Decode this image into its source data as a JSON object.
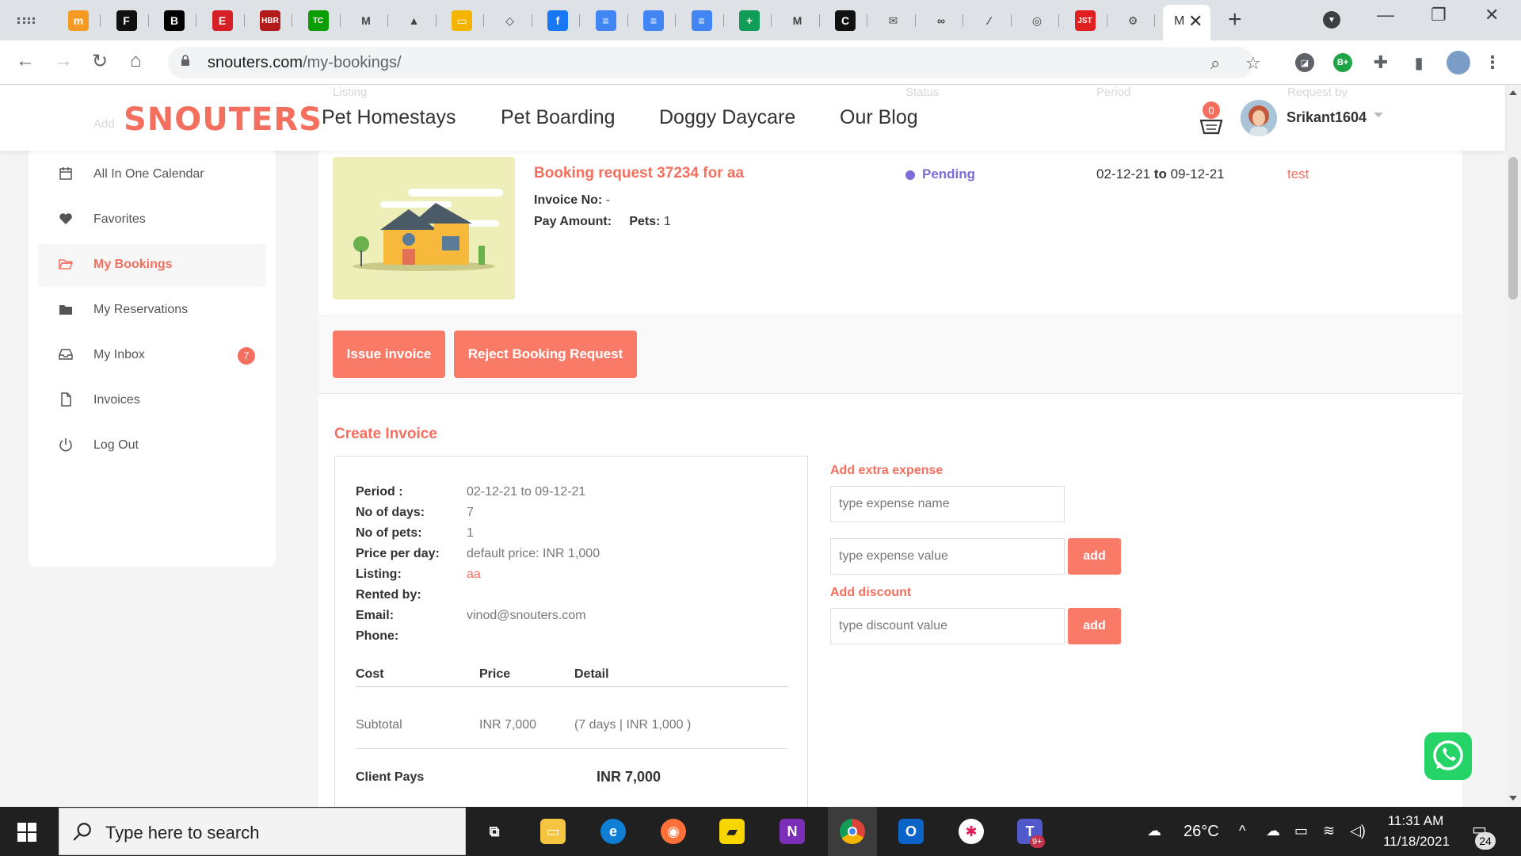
{
  "browser": {
    "active_tab_title": "M",
    "new_tab_glyph": "+",
    "url_host": "snouters.com",
    "url_path": "/my-bookings/",
    "tabs": [
      {
        "label": "m",
        "color": "#f59a23"
      },
      {
        "label": "F",
        "color": "#111111"
      },
      {
        "label": "B",
        "color": "#000000"
      },
      {
        "label": "E",
        "color": "#d62027"
      },
      {
        "label": "HBR",
        "color": "#b31b1b"
      },
      {
        "label": "TC",
        "color": "#0a9e01"
      },
      {
        "label": "M",
        "color": "#ffffff"
      },
      {
        "label": "▲",
        "color": "#ffffff"
      },
      {
        "label": "▭",
        "color": "#f4b400"
      },
      {
        "label": "◇",
        "color": "#ffffff"
      },
      {
        "label": "f",
        "color": "#1877f2"
      },
      {
        "label": "≡",
        "color": "#4285f4"
      },
      {
        "label": "≡",
        "color": "#4285f4"
      },
      {
        "label": "≡",
        "color": "#4285f4"
      },
      {
        "label": "+",
        "color": "#0f9d58"
      },
      {
        "label": "M",
        "color": "#ffffff"
      },
      {
        "label": "C",
        "color": "#111111"
      },
      {
        "label": "✉",
        "color": "#ffffff"
      },
      {
        "label": "∞",
        "color": "#ffffff"
      },
      {
        "label": "⁄",
        "color": "#ffffff"
      },
      {
        "label": "◎",
        "color": "#ffffff"
      },
      {
        "label": "JST",
        "color": "#e02020"
      },
      {
        "label": "⚙",
        "color": "#ffffff"
      }
    ],
    "extensions": [
      {
        "label": "B+",
        "color": "#1ea446"
      }
    ]
  },
  "site": {
    "logo": "SNOUTERS",
    "nav": [
      "Pet Homestays",
      "Pet Boarding",
      "Doggy Daycare",
      "Our Blog"
    ],
    "cart_count": "0",
    "username": "Srikant1604",
    "ghost_headers": [
      "Listing",
      "Status",
      "Period",
      "Request by"
    ],
    "ghost_add": "Add",
    "accent": "#f46f5e"
  },
  "sidebar": {
    "items": [
      {
        "label": "All In One Calendar",
        "icon": "calendar-icon"
      },
      {
        "label": "Favorites",
        "icon": "heart-icon"
      },
      {
        "label": "My Bookings",
        "icon": "folder-open-icon"
      },
      {
        "label": "My Reservations",
        "icon": "folder-icon"
      },
      {
        "label": "My Inbox",
        "icon": "inbox-icon",
        "badge": "7"
      },
      {
        "label": "Invoices",
        "icon": "file-icon"
      },
      {
        "label": "Log Out",
        "icon": "power-icon"
      }
    ]
  },
  "booking": {
    "title": "Booking request 37234 for aa",
    "invoice_label": "Invoice No:",
    "invoice_value": "-",
    "pay_label": "Pay Amount:",
    "pets_label": "Pets:",
    "pets_value": "1",
    "status": "Pending",
    "status_color": "#7c6bd8",
    "period_from": "02-12-21",
    "period_to_word": "to",
    "period_to": "09-12-21",
    "requester": "test"
  },
  "actions": {
    "issue_invoice": "Issue invoice",
    "reject": "Reject Booking Request"
  },
  "invoice": {
    "title": "Create Invoice",
    "details": [
      {
        "key": "Period :",
        "value": "02-12-21 to 09-12-21"
      },
      {
        "key": "No of days:",
        "value": "7"
      },
      {
        "key": "No of pets:",
        "value": "1"
      },
      {
        "key": "Price per day:",
        "value": "default price: INR 1,000"
      },
      {
        "key": "Listing:",
        "value": "aa"
      },
      {
        "key": "Rented by:",
        "value": ""
      },
      {
        "key": "Email:",
        "value": "vinod@snouters.com"
      },
      {
        "key": "Phone:",
        "value": ""
      }
    ],
    "cost_headers": [
      "Cost",
      "Price",
      "Detail"
    ],
    "cost_rows": [
      {
        "cost": "Subtotal",
        "price": "INR 7,000",
        "detail": "(7 days | INR 1,000 )"
      }
    ],
    "client_pays_label": "Client Pays",
    "client_pays_value": "INR 7,000"
  },
  "extra": {
    "expense_title": "Add extra expense",
    "expense_name_placeholder": "type expense name",
    "expense_value_placeholder": "type expense value",
    "add_label": "add",
    "discount_title": "Add discount",
    "discount_placeholder": "type discount value"
  },
  "taskbar": {
    "search_placeholder": "Type here to search",
    "weather": "26°C",
    "time": "11:31 AM",
    "date": "11/18/2021",
    "notifications": "24",
    "teams_badge": "9+"
  }
}
